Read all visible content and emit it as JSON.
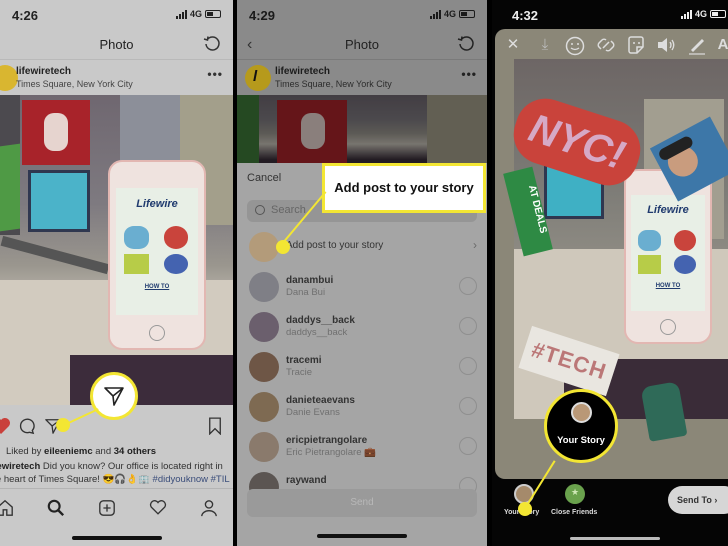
{
  "colors": {
    "callout_yellow": "#f3e633",
    "like_red": "#c9403b"
  },
  "panel1": {
    "status": {
      "time": "4:26",
      "network": "4G"
    },
    "nav_title": "Photo",
    "post": {
      "username": "lifewiretech",
      "location": "Times Square, New York City",
      "liked_by_prefix": "Liked by",
      "liked_by_user": "eileeniemc",
      "liked_by_mid": "and",
      "liked_by_others": "34 others",
      "caption_user": "lifewiretech",
      "caption_text": "Did you know? Our office is located right in the heart of Times Square! 😎🎧👌🏢",
      "hashtags": "#didyouknow #TIL #lifewire #timessquare #nyc"
    },
    "icons": [
      "heart-icon",
      "comment-icon",
      "share-paper-plane-icon",
      "bookmark-icon"
    ],
    "tabs": [
      "home",
      "search",
      "new-post",
      "activity",
      "profile"
    ],
    "photo_phone_logo": "Lifewire",
    "photo_phone_text": "HOW TO"
  },
  "panel2": {
    "status": {
      "time": "4:29",
      "network": "4G"
    },
    "nav_title": "Photo",
    "post": {
      "username": "lifewiretech",
      "location": "Times Square, New York City"
    },
    "cancel_label": "Cancel",
    "search_placeholder": "Search",
    "add_to_story_label": "Add post to your story",
    "recipients": [
      {
        "username": "danambui",
        "name": "Dana Bui"
      },
      {
        "username": "daddys__back",
        "name": "daddys__back"
      },
      {
        "username": "tracemi",
        "name": "Tracie"
      },
      {
        "username": "danieteaevans",
        "name": "Danie Evans"
      },
      {
        "username": "ericpietrangolare",
        "name": "Eric Pietrangolare 💼"
      },
      {
        "username": "raywand",
        "name": ""
      }
    ],
    "send_label": "Send",
    "callout_text": "Add post to your story"
  },
  "panel3": {
    "status": {
      "time": "4:32",
      "network": "4G"
    },
    "tools": [
      "close",
      "download",
      "face-effects",
      "link",
      "sticker",
      "sound",
      "draw",
      "text"
    ],
    "stickers": {
      "nyc": "NYC!",
      "tech": "#TECH",
      "deals": "AT DEALS"
    },
    "your_story_label": "Your Story",
    "close_friends_label": "Close Friends",
    "send_to_label": "Send To",
    "callout_text": "Your Story"
  }
}
